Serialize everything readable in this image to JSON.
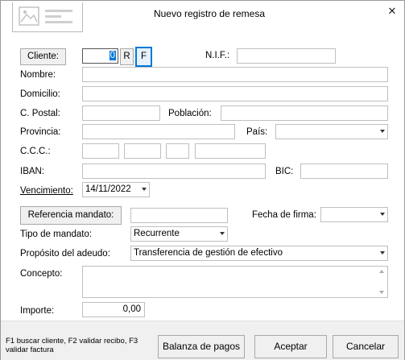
{
  "window": {
    "title": "Nuevo registro de remesa",
    "close_glyph": "✕"
  },
  "cliente": {
    "button_label": "Cliente:",
    "code_value": "0",
    "r_label": "R",
    "f_label": "F",
    "nif_label": "N.I.F.:",
    "nif_value": ""
  },
  "labels": {
    "nombre": "Nombre:",
    "domicilio": "Domicilio:",
    "cpostal": "C. Postal:",
    "poblacion": "Población:",
    "provincia": "Provincia:",
    "pais": "País:",
    "ccc": "C.C.C.:",
    "iban": "IBAN:",
    "bic": "BIC:",
    "vencimiento": "Vencimiento:",
    "fecha_firma": "Fecha de firma:",
    "tipo_mandato": "Tipo de mandato:",
    "proposito": "Propósito del adeudo:",
    "concepto": "Concepto:",
    "importe": "Importe:"
  },
  "values": {
    "vencimiento": "14/11/2022",
    "tipo_mandato": "Recurrente",
    "proposito": "Transferencia de gestión de efectivo",
    "importe": "0,00"
  },
  "buttons": {
    "referencia": "Referencia mandato:",
    "balanza": "Balanza de pagos",
    "aceptar": "Aceptar",
    "cancelar": "Cancelar"
  },
  "footer": {
    "hint": "F1 buscar cliente, F2 validar recibo, F3 validar factura"
  },
  "colors": {
    "focus": "#0078d7",
    "window_bg": "#ffffff",
    "footer_bg": "#f0f0f0"
  }
}
